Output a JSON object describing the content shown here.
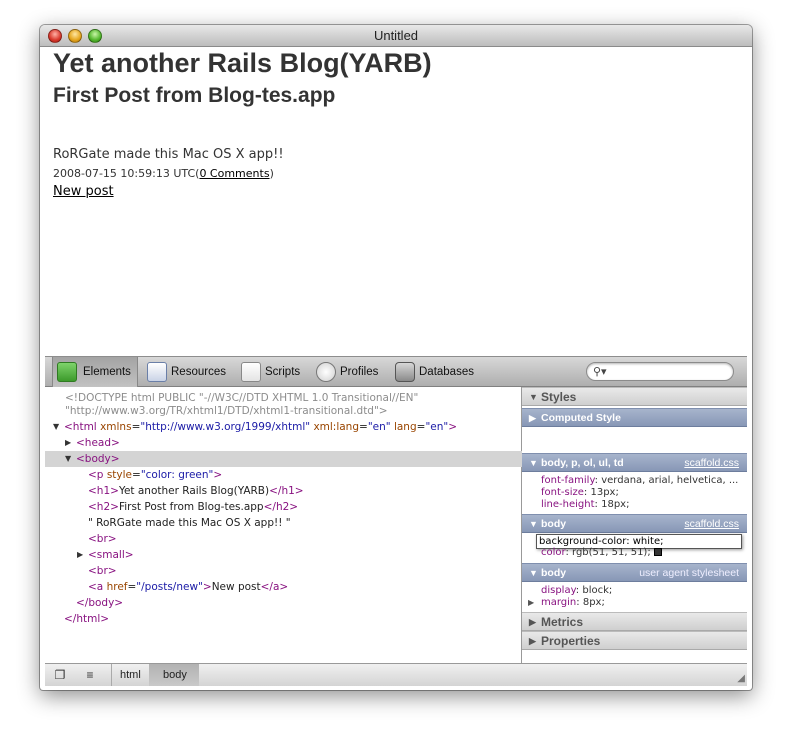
{
  "window": {
    "title": "Untitled"
  },
  "webview": {
    "h1": "Yet another Rails Blog(YARB)",
    "h2": "First Post from Blog-tes.app",
    "paragraph": "RoRGate made this Mac OS X app!!",
    "timestamp": "2008-07-15 10:59:13 UTC",
    "comments_link": "0 Comments",
    "paren_open": "(",
    "paren_close": ")",
    "new_post_link": "New post"
  },
  "toolbar": {
    "elements": "Elements",
    "resources": "Resources",
    "scripts": "Scripts",
    "profiles": "Profiles",
    "databases": "Databases",
    "search_placeholder": ""
  },
  "dom": {
    "doctype1": "<!DOCTYPE html PUBLIC \"-//W3C//DTD XHTML 1.0 Transitional//EN\"",
    "doctype2": "\"http://www.w3.org/TR/xhtml1/DTD/xhtml1-transitional.dtd\">",
    "html_open_tag": "<html",
    "html_attr1": "xmlns",
    "html_val1": "\"http://www.w3.org/1999/xhtml\"",
    "html_attr2": "xml:lang",
    "html_val2": "\"en\"",
    "html_attr3": "lang",
    "html_val3": "\"en\"",
    "head": "<head>",
    "body_open": "<body>",
    "p_tag": "<p",
    "p_attr": "style",
    "p_val": "\"color: green\"",
    "h1_open": "<h1>",
    "h1_text": "Yet another Rails Blog(YARB)",
    "h1_close": "</h1>",
    "h2_open": "<h2>",
    "h2_text": "First Post from Blog-tes.app",
    "h2_close": "</h2>",
    "text_node": "\" RoRGate made this Mac OS X app!! \"",
    "br": "<br>",
    "small": "<small>",
    "a_tag": "<a",
    "a_attr": "href",
    "a_val": "\"/posts/new\"",
    "a_text": "New post",
    "a_close": "</a>",
    "body_close": "</body>",
    "html_close": "</html>"
  },
  "styles": {
    "styles_header": "Styles",
    "computed_header": "Computed Style",
    "rule1_selector": "body, p, ol, ul, td",
    "rule1_source": "scaffold.css",
    "rule1_props": [
      {
        "name": "font-family",
        "value": "verdana, arial, helvetica, ..."
      },
      {
        "name": "font-size",
        "value": "13px;"
      },
      {
        "name": "line-height",
        "value": "18px;"
      }
    ],
    "rule2_selector": "body",
    "rule2_source": "scaffold.css",
    "rule2_edit": "background-color: white;",
    "rule2_prop_name": "color",
    "rule2_prop_value": "rgb(51, 51, 51);",
    "rule3_selector": "body",
    "rule3_source": "user agent stylesheet",
    "rule3_props": [
      {
        "name": "display",
        "value": "block;"
      },
      {
        "name": "margin",
        "value": "8px;"
      }
    ],
    "metrics_header": "Metrics",
    "properties_header": "Properties"
  },
  "statusbar": {
    "crumb_html": "html",
    "crumb_body": "body"
  },
  "colors": {
    "doc_text": "#333333",
    "tag": "#881280",
    "attr": "#994500",
    "value": "#1a1aa6"
  }
}
